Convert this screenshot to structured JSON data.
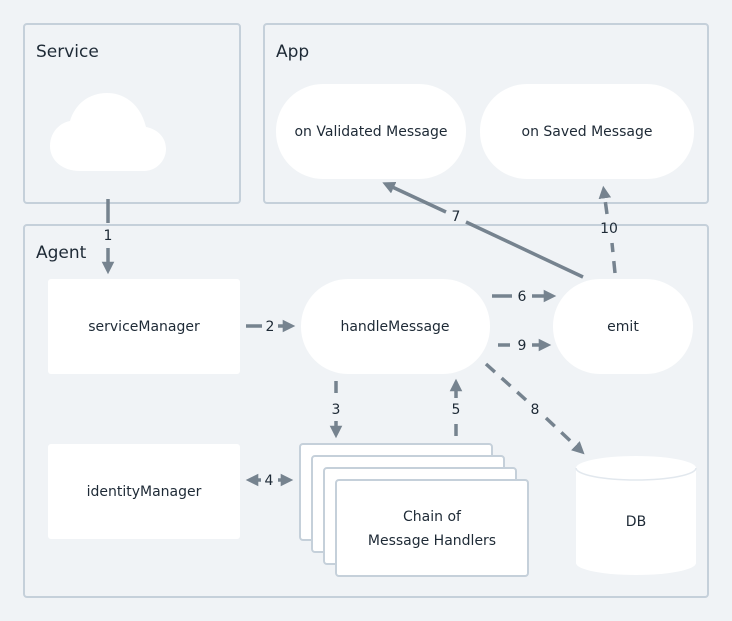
{
  "groups": {
    "service": "Service",
    "app": "App",
    "agent": "Agent"
  },
  "nodes": {
    "on_validated": "on Validated Message",
    "on_saved": "on Saved Message",
    "service_manager": "serviceManager",
    "handle_message": "handleMessage",
    "emit": "emit",
    "identity_manager": "identityManager",
    "chain_line1": "Chain of",
    "chain_line2": "Message Handlers",
    "db": "DB"
  },
  "edges": {
    "e1": "1",
    "e2": "2",
    "e3": "3",
    "e4": "4",
    "e5": "5",
    "e6": "6",
    "e7": "7",
    "e8": "8",
    "e9": "9",
    "e10": "10"
  },
  "colors": {
    "background": "#f0f3f6",
    "border": "#c5d0da",
    "arrow": "#76838f",
    "text": "#1e2a36"
  }
}
